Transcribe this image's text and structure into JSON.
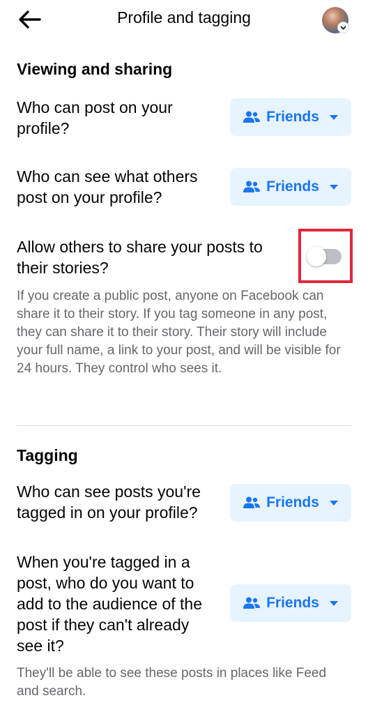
{
  "header": {
    "title": "Profile and tagging",
    "back_icon": "arrow-left-icon",
    "avatar_icon": "profile-avatar"
  },
  "colors": {
    "accent": "#1877f2",
    "button_bg": "#e7f3ff",
    "highlight": "#e0283c",
    "secondary_text": "#65676b"
  },
  "viewing_sharing": {
    "title": "Viewing and sharing",
    "q1": {
      "lines": [
        "Who can post on your",
        "profile?"
      ],
      "audience": "Friends"
    },
    "q2": {
      "lines": [
        "Who can see what others",
        "post on your profile?"
      ],
      "audience": "Friends"
    },
    "share_stories": {
      "lines": [
        "Allow others to share your posts to",
        "their stories?"
      ],
      "enabled": false,
      "description": "If you create a public post, anyone on Facebook can share it to their story. If you tag someone in any post, they can share it to their story. Their story will include your full name, a link to your post, and will be visible for 24 hours. They control who sees it."
    }
  },
  "tagging": {
    "title": "Tagging",
    "q1": {
      "lines": [
        "Who can see posts you're",
        "tagged in on your profile?"
      ],
      "audience": "Friends"
    },
    "q2": {
      "lines": [
        "When you're tagged in a",
        "post, who do you want to",
        "add to the audience of the",
        "post if they can't already",
        "see it?"
      ],
      "audience": "Friends"
    },
    "description": "They'll be able to see these posts in places like Feed and search."
  }
}
